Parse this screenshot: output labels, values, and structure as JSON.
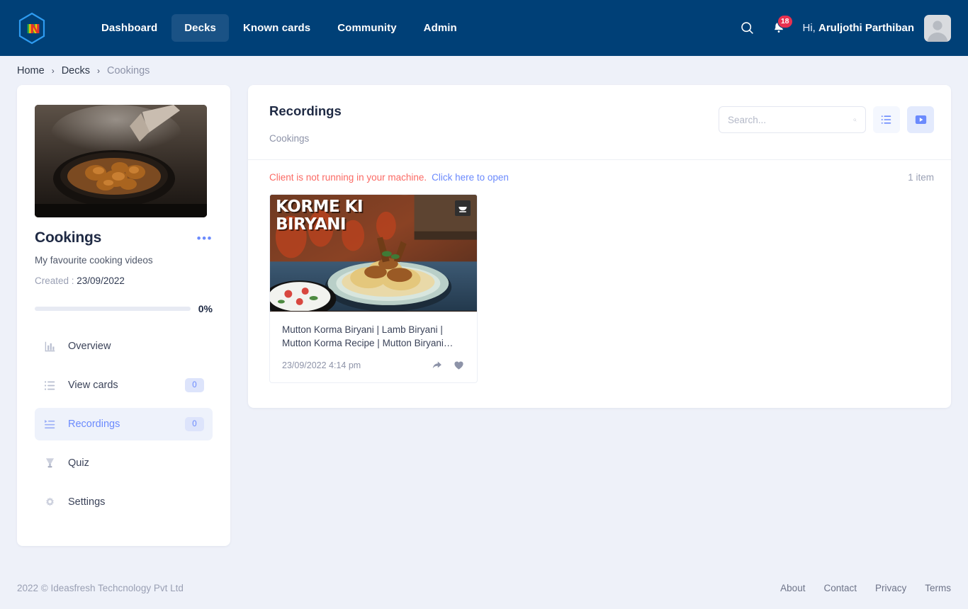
{
  "brand": {
    "logo_letter": "N",
    "logo_name": "hexagon-n-logo"
  },
  "nav": {
    "items": [
      {
        "label": "Dashboard",
        "active": false
      },
      {
        "label": "Decks",
        "active": true
      },
      {
        "label": "Known cards",
        "active": false
      },
      {
        "label": "Community",
        "active": false
      },
      {
        "label": "Admin",
        "active": false
      }
    ],
    "search_icon": "search-icon",
    "bell_icon": "notification-bell-icon",
    "notification_count": "18",
    "greeting_prefix": "Hi, ",
    "user_name": "Aruljothi Parthiban",
    "avatar_icon": "user-avatar-icon"
  },
  "breadcrumb": {
    "items": [
      {
        "label": "Home",
        "current": false
      },
      {
        "label": "Decks",
        "current": false
      },
      {
        "label": "Cookings",
        "current": true
      }
    ],
    "separator": "›"
  },
  "sidebar": {
    "deck_image_alt": "cooking-pan-thumbnail",
    "deck_title": "Cookings",
    "menu_icon": "more-options-icon",
    "menu_dots": "•••",
    "deck_description": "My favourite cooking videos",
    "created_label": "Created : ",
    "created_date": "23/09/2022",
    "progress_percent": "0%",
    "progress_value": 0,
    "menu_items": [
      {
        "label": "Overview",
        "icon": "bar-chart-icon",
        "badge": null,
        "active": false
      },
      {
        "label": "View cards",
        "icon": "list-icon",
        "badge": "0",
        "active": false
      },
      {
        "label": "Recordings",
        "icon": "playlist-icon",
        "badge": "0",
        "active": true
      },
      {
        "label": "Quiz",
        "icon": "trophy-icon",
        "badge": null,
        "active": false
      },
      {
        "label": "Settings",
        "icon": "gear-icon",
        "badge": null,
        "active": false
      }
    ]
  },
  "main": {
    "title": "Recordings",
    "subtitle": "Cookings",
    "search": {
      "placeholder": "Search...",
      "value": "",
      "icon": "search-icon"
    },
    "view_toggles": [
      {
        "icon": "list-view-icon",
        "active": false
      },
      {
        "icon": "video-view-icon",
        "active": true
      }
    ],
    "alert_text": "Client is not running in your machine.",
    "alert_link": "Click here to open",
    "item_count": "1 item",
    "recordings": [
      {
        "thumbnail_title_line1": "KORME KI",
        "thumbnail_title_line2": "BIRYANI",
        "thumbnail_badge": "channel-logo-badge",
        "title": "Mutton Korma Biryani | Lamb Biryani | Mutton Korma Recipe | Mutton Biryani…",
        "date": "23/09/2022 4:14 pm",
        "share_icon": "share-icon",
        "favorite_icon": "heart-icon"
      }
    ]
  },
  "footer": {
    "copyright": "2022 © Ideasfresh Techcnology Pvt Ltd",
    "links": [
      {
        "label": "About"
      },
      {
        "label": "Contact"
      },
      {
        "label": "Privacy"
      },
      {
        "label": "Terms"
      }
    ]
  },
  "colors": {
    "header_bg": "#004077",
    "header_active_tab": "#1a5285",
    "page_bg": "#eef1f9",
    "accent_blue": "#6b8afd",
    "badge_bg": "#dde4fb",
    "alert_red": "#fb6a64",
    "notification_red": "#e8304f"
  }
}
